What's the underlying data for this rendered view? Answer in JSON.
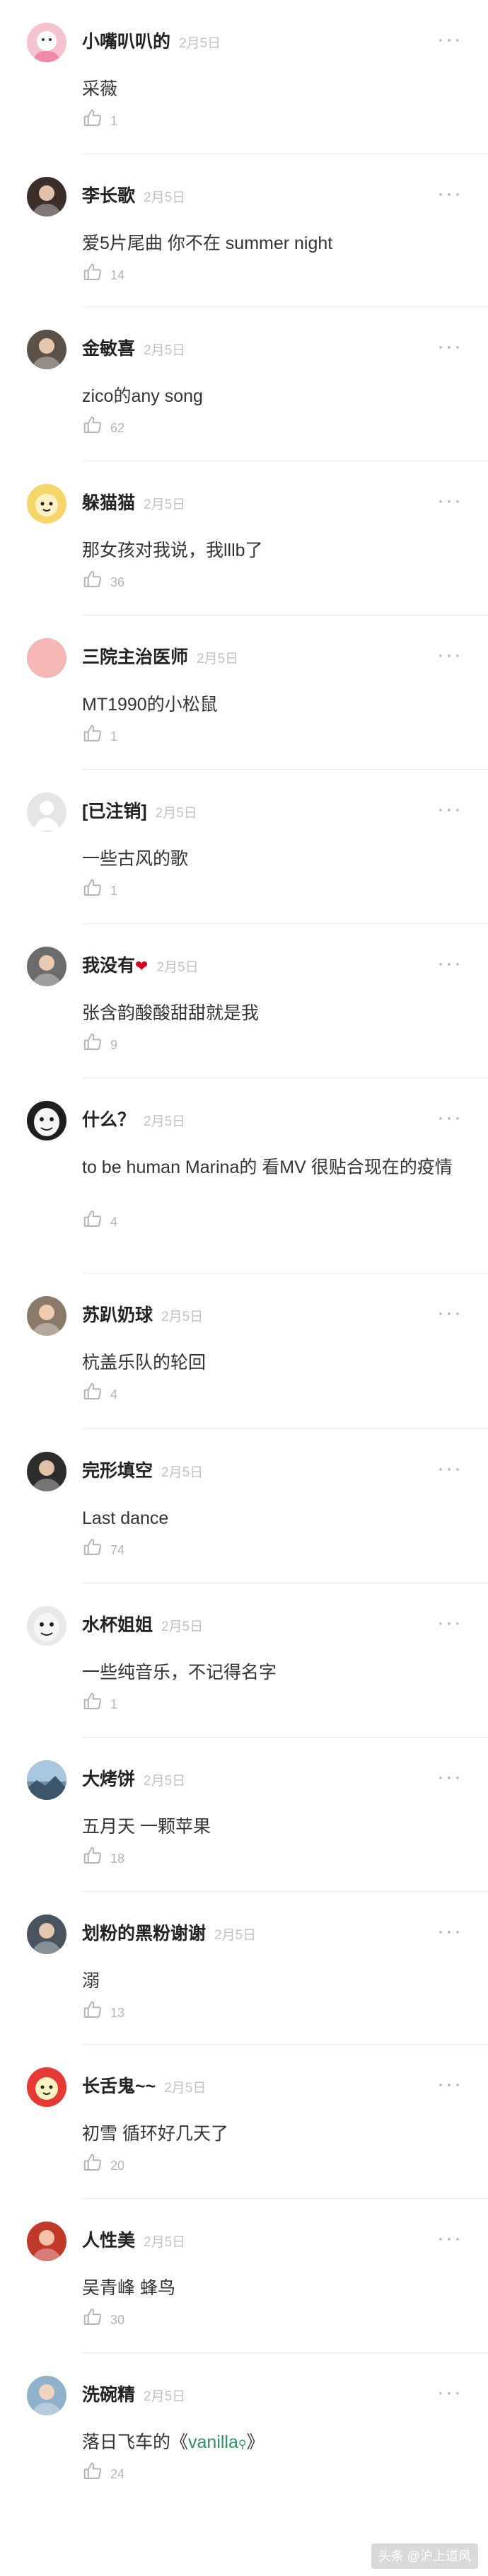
{
  "comments": [
    {
      "user": "小嘴叭叭的",
      "date": "2月5日",
      "text": "采薇",
      "likes": "1",
      "avatar_icon": "pink-character-avatar-icon",
      "avatar_color": "#f3c4cf"
    },
    {
      "user": "李长歌",
      "date": "2月5日",
      "text": "爱5片尾曲 你不在 summer night",
      "likes": "14",
      "avatar_icon": "person-photo-avatar-icon",
      "avatar_color": "#3a2f2a"
    },
    {
      "user": "金敏喜",
      "date": "2月5日",
      "text": "zico的any song",
      "likes": "62",
      "avatar_icon": "woman-photo-avatar-icon",
      "avatar_color": "#5b5148"
    },
    {
      "user": "躲猫猫",
      "date": "2月5日",
      "text": "那女孩对我说，我lllb了",
      "likes": "36",
      "avatar_icon": "cartoon-avatar-icon",
      "avatar_color": "#f5d66b"
    },
    {
      "user": "三院主治医师",
      "date": "2月5日",
      "text": "MT1990的小松鼠",
      "likes": "1",
      "avatar_icon": "pink-circle-avatar-icon",
      "avatar_color": "#f5b6b6"
    },
    {
      "user": "[已注销]",
      "date": "2月5日",
      "text": "一些古风的歌",
      "likes": "1",
      "avatar_icon": "default-user-avatar-icon",
      "avatar_color": "#e4e4e4"
    },
    {
      "user": "我没有",
      "date": "2月5日",
      "text": "张含韵酸酸甜甜就是我",
      "likes": "9",
      "avatar_icon": "person-photo-avatar-icon",
      "avatar_color": "#6b6b6b",
      "emoji": "❤"
    },
    {
      "user": "什么？",
      "date": "2月5日",
      "text": "to be human Marina的 看MV 很贴合现在的疫情",
      "likes": "4",
      "avatar_icon": "meme-face-avatar-icon",
      "avatar_color": "#1e1e1e"
    },
    {
      "user": "苏趴奶球",
      "date": "2月5日",
      "text": "杭盖乐队的轮回",
      "likes": "4",
      "avatar_icon": "person-photo-avatar-icon",
      "avatar_color": "#8a7a6a"
    },
    {
      "user": "完形填空",
      "date": "2月5日",
      "text": "Last dance",
      "likes": "74",
      "avatar_icon": "person-photo-avatar-icon",
      "avatar_color": "#2c2c2c"
    },
    {
      "user": "水杯姐姐",
      "date": "2月5日",
      "text": "一些纯音乐，不记得名字",
      "likes": "1",
      "avatar_icon": "meme-face-avatar-icon",
      "avatar_color": "#e8e8e8"
    },
    {
      "user": "大烤饼",
      "date": "2月5日",
      "text": "五月天 一颗苹果",
      "likes": "18",
      "avatar_icon": "landscape-avatar-icon",
      "avatar_color": "#6f8fa8"
    },
    {
      "user": "划粉的黑粉谢谢",
      "date": "2月5日",
      "text": "溺",
      "likes": "13",
      "avatar_icon": "person-photo-avatar-icon",
      "avatar_color": "#4a5360"
    },
    {
      "user": "长舌鬼~~",
      "date": "2月5日",
      "text": "初雪 循环好几天了",
      "likes": "20",
      "avatar_icon": "cartoon-avatar-icon",
      "avatar_color": "#e53935"
    },
    {
      "user": "人性美",
      "date": "2月5日",
      "text": "吴青峰 蜂鸟",
      "likes": "30",
      "avatar_icon": "person-photo-avatar-icon",
      "avatar_color": "#c0392b"
    },
    {
      "user": "洗碗精",
      "date": "2月5日",
      "text_prefix": "落日飞车的《",
      "link": "vanilla",
      "text_suffix": "》",
      "likes": "24",
      "avatar_icon": "person-photo-avatar-icon",
      "avatar_color": "#8fb1c9"
    }
  ],
  "more_label": "···",
  "watermark": "头条 @沪上道风",
  "colors": {
    "link": "#2f8f5e",
    "divider": "#ececec",
    "date": "#c2c2c2"
  }
}
